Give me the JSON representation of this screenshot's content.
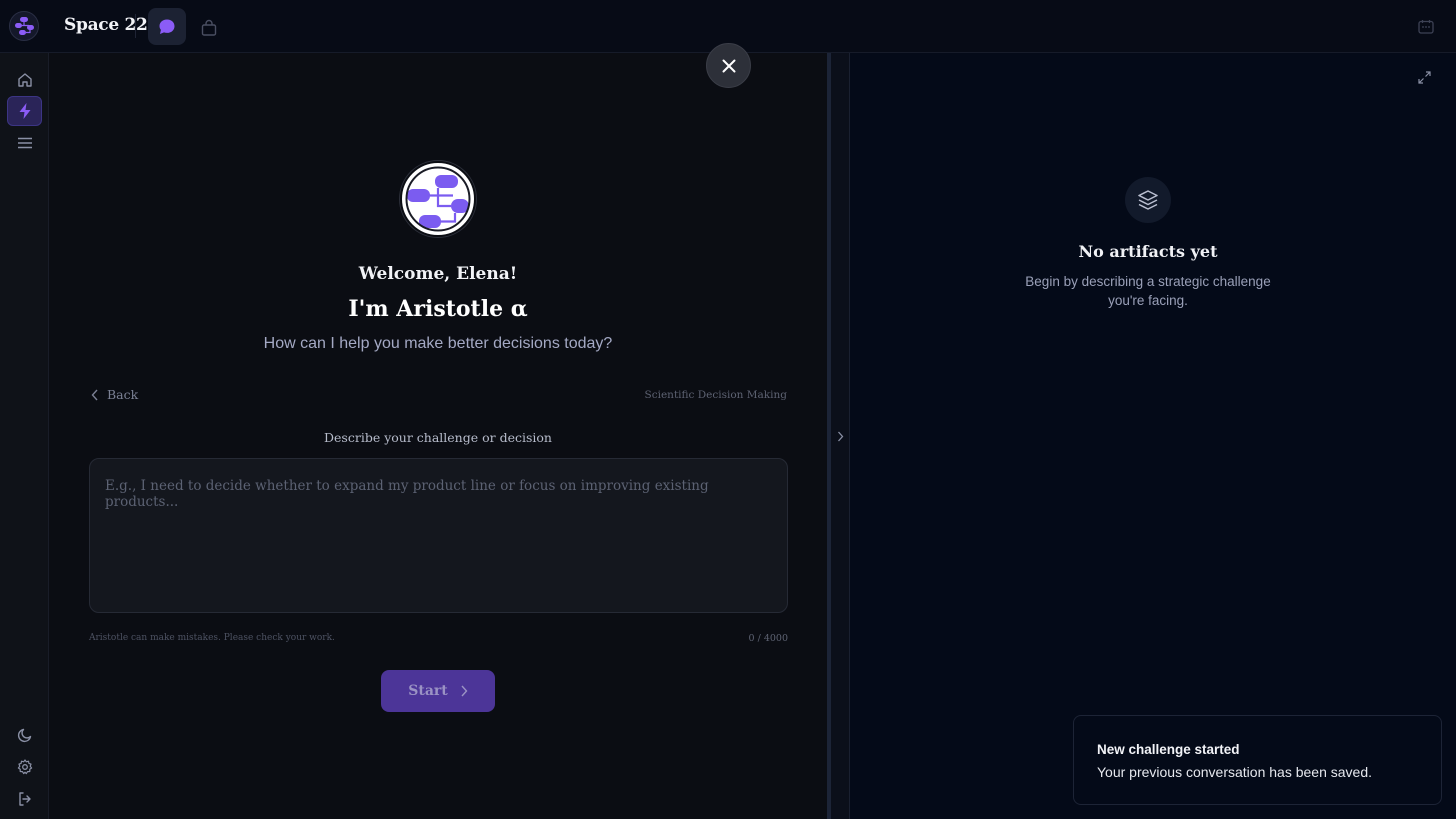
{
  "app": {
    "title": "Space 22"
  },
  "topbar": {
    "tabs": [
      {
        "icon": "chat-bubble-icon",
        "active": true
      },
      {
        "icon": "shopping-bag-icon",
        "active": false
      }
    ],
    "right_icon": "calendar-icon"
  },
  "sidebar": {
    "top_items": [
      {
        "icon": "home-icon",
        "active": false
      },
      {
        "icon": "lightning-icon",
        "active": true
      },
      {
        "icon": "menu-icon",
        "active": false
      }
    ],
    "bottom_items": [
      {
        "icon": "moon-icon"
      },
      {
        "icon": "gear-icon"
      },
      {
        "icon": "logout-icon"
      }
    ]
  },
  "chat": {
    "welcome": "Welcome, Elena!",
    "assistant_intro": "I'm Aristotle α",
    "question": "How can I help you make better decisions today?",
    "back_label": "Back",
    "mode_label": "Scientific Decision Making",
    "prompt_label": "Describe your challenge or decision",
    "input": {
      "value": "",
      "placeholder": "E.g., I need to decide whether to expand my product line or focus on improving existing products..."
    },
    "disclaimer": "Aristotle can make mistakes. Please check your work.",
    "char_count": "0 / 4000",
    "start_label": "Start"
  },
  "artifacts": {
    "title": "No artifacts yet",
    "subtitle": "Begin by describing a strategic challenge you're facing."
  },
  "toast": {
    "title": "New challenge started",
    "body": "Your previous conversation has been saved."
  },
  "colors": {
    "accent": "#7b5cf0",
    "start_button": "#4c3598",
    "background": "#0b0d13"
  }
}
